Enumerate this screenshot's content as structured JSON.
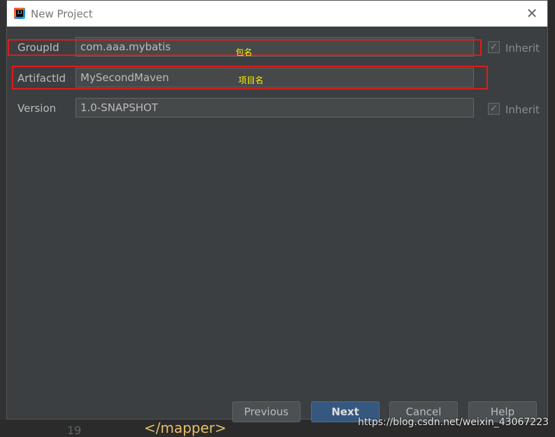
{
  "window": {
    "title": "New Project",
    "close_glyph": "✕"
  },
  "form": {
    "group_id": {
      "label": "GroupId",
      "value": "com.aaa.mybatis",
      "inherit_label": "Inherit",
      "inherit_checked": true
    },
    "artifact_id": {
      "label": "ArtifactId",
      "value": "MySecondMaven"
    },
    "version": {
      "label": "Version",
      "value": "1.0-SNAPSHOT",
      "inherit_label": "Inherit",
      "inherit_checked": true
    }
  },
  "annotations": {
    "group_note": "包名",
    "artifact_note": "项目名"
  },
  "buttons": {
    "previous": "Previous",
    "next": "Next",
    "cancel": "Cancel",
    "help": "Help"
  },
  "background": {
    "line_number": "19",
    "code_tag": "</mapper>",
    "watermark": "https://blog.csdn.net/weixin_43067223"
  },
  "colors": {
    "dialog_bg": "#3c3f41",
    "highlight": "#e11b1b",
    "annotation": "#ffee00",
    "primary_button": "#365880"
  }
}
